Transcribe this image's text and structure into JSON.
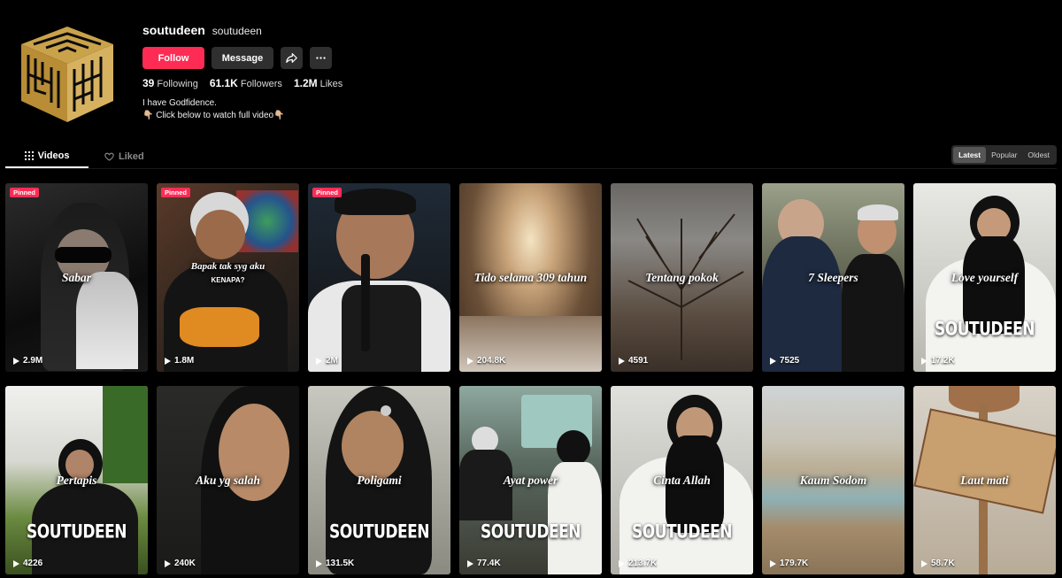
{
  "profile": {
    "username": "soutudeen",
    "nickname": "soutudeen",
    "follow_label": "Follow",
    "message_label": "Message",
    "stats": [
      {
        "value": "39",
        "label": "Following"
      },
      {
        "value": "61.1K",
        "label": "Followers"
      },
      {
        "value": "1.2M",
        "label": "Likes"
      }
    ],
    "bio_line1": "I have Godfidence.",
    "bio_line2": "👇🏼 Click below to watch full video👇🏼"
  },
  "tabs": {
    "videos": "Videos",
    "liked": "Liked"
  },
  "sort": {
    "latest": "Latest",
    "popular": "Popular",
    "oldest": "Oldest"
  },
  "colors": {
    "accent": "#fe2c55",
    "background": "#000000"
  },
  "videos": [
    {
      "title": "Sabar",
      "views": "2.9M",
      "pinned": "Pinned"
    },
    {
      "title": "Bapak tak syg aku",
      "subtitle": "KENAPA?",
      "views": "1.8M",
      "pinned": "Pinned"
    },
    {
      "title": "",
      "views": "2M",
      "pinned": "Pinned"
    },
    {
      "title": "Tido selama 309 tahun",
      "views": "204.8K"
    },
    {
      "title": "Tentang pokok",
      "views": "4591"
    },
    {
      "title": "7 Sleepers",
      "views": "7525"
    },
    {
      "title": "Love yourself",
      "views": "17.2K",
      "watermark": "SOUTUDEEN"
    },
    {
      "title": "Pertapis",
      "views": "4226",
      "watermark": "SOUTUDEEN"
    },
    {
      "title": "Aku yg salah",
      "views": "240K"
    },
    {
      "title": "Poligami",
      "views": "131.5K",
      "watermark": "SOUTUDEEN"
    },
    {
      "title": "Ayat power",
      "views": "77.4K",
      "watermark": "SOUTUDEEN"
    },
    {
      "title": "Cinta Allah",
      "views": "213.7K",
      "watermark": "SOUTUDEEN"
    },
    {
      "title": "Kaum Sodom",
      "views": "179.7K"
    },
    {
      "title": "Laut mati",
      "views": "58.7K"
    }
  ]
}
